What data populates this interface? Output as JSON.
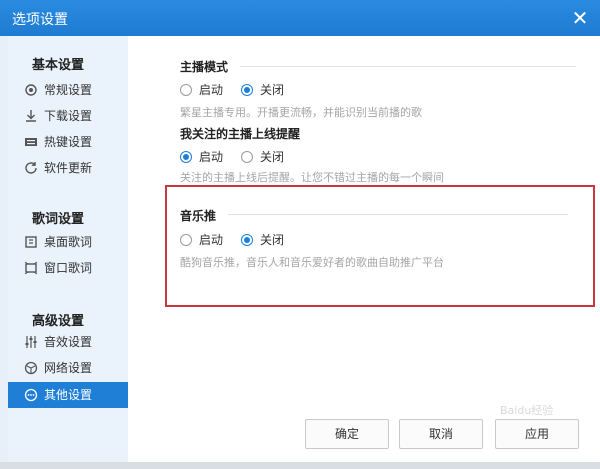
{
  "window": {
    "title": "选项设置",
    "close_symbol": "✕"
  },
  "sidebar": {
    "sections": [
      {
        "title": "基本设置",
        "items": [
          {
            "label": "常规设置",
            "icon": "gear-icon"
          },
          {
            "label": "下载设置",
            "icon": "download-icon"
          },
          {
            "label": "热键设置",
            "icon": "keyboard-icon"
          },
          {
            "label": "软件更新",
            "icon": "refresh-icon"
          }
        ]
      },
      {
        "title": "歌词设置",
        "items": [
          {
            "label": "桌面歌词",
            "icon": "desktop-lyrics-icon"
          },
          {
            "label": "窗口歌词",
            "icon": "window-lyrics-icon"
          }
        ]
      },
      {
        "title": "高级设置",
        "items": [
          {
            "label": "音效设置",
            "icon": "equalizer-icon"
          },
          {
            "label": "网络设置",
            "icon": "network-icon"
          },
          {
            "label": "其他设置",
            "icon": "more-icon",
            "active": true
          }
        ]
      }
    ]
  },
  "main": {
    "groups": [
      {
        "title": "主播模式",
        "options": [
          "启动",
          "关闭"
        ],
        "selected": 1,
        "desc": "繁星主播专用。开播更流畅，并能识别当前播的歌"
      },
      {
        "title": "我关注的主播上线提醒",
        "options": [
          "启动",
          "关闭"
        ],
        "selected": 0,
        "desc": "关注的主播上线后提醒。让您不错过主播的每一个瞬间"
      },
      {
        "title": "音乐推",
        "options": [
          "启动",
          "关闭"
        ],
        "selected": 1,
        "desc": "酷狗音乐推，音乐人和音乐爱好者的歌曲自助推广平台"
      }
    ],
    "buttons": {
      "ok": "确定",
      "cancel": "取消",
      "apply": "应用"
    }
  },
  "watermark": "Baidu经验",
  "colors": {
    "titlebar": "#1e7bd2",
    "accent": "#1f7fd6",
    "highlight": "#c9363c"
  }
}
